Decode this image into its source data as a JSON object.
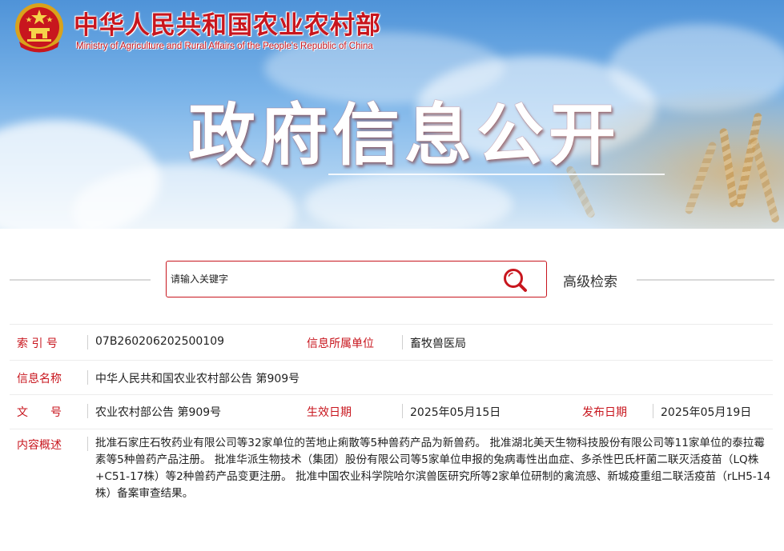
{
  "header": {
    "ministry_name_cn": "中华人民共和国农业农村部",
    "ministry_name_en": "Ministry of Agriculture and Rural Affairs of the People's Republic of China",
    "section_title": "政府信息公开",
    "emblem_icon": "national-emblem-icon"
  },
  "search": {
    "placeholder": "请输入关键字",
    "search_icon": "search-icon",
    "advanced_label": "高级检索"
  },
  "info": {
    "index_label": "索 引 号",
    "index_value": "07B260206202500109",
    "unit_label": "信息所属单位",
    "unit_value": "畜牧兽医局",
    "name_label": "信息名称",
    "name_value": "中华人民共和国农业农村部公告 第909号",
    "doc_label": "文　　号",
    "doc_value": "农业农村部公告 第909号",
    "effective_label": "生效日期",
    "effective_value": "2025年05月15日",
    "publish_label": "发布日期",
    "publish_value": "2025年05月19日",
    "summary_label": "内容概述",
    "summary_value": "批准石家庄石牧药业有限公司等32家单位的苦地止痢散等5种兽药产品为新兽药。 批准湖北美天生物科技股份有限公司等11家单位的泰拉霉素等5种兽药产品注册。 批准华派生物技术（集团）股份有限公司等5家单位申报的兔病毒性出血症、多杀性巴氏杆菌二联灭活疫苗（LQ株+C51-17株）等2种兽药产品变更注册。 批准中国农业科学院哈尔滨兽医研究所等2家单位研制的禽流感、新城疫重组二联活疫苗（rLH5-14株）备案审查结果。"
  },
  "colors": {
    "accent_red": "#c8161e",
    "text_dark": "#222222",
    "divider": "#ececec"
  }
}
